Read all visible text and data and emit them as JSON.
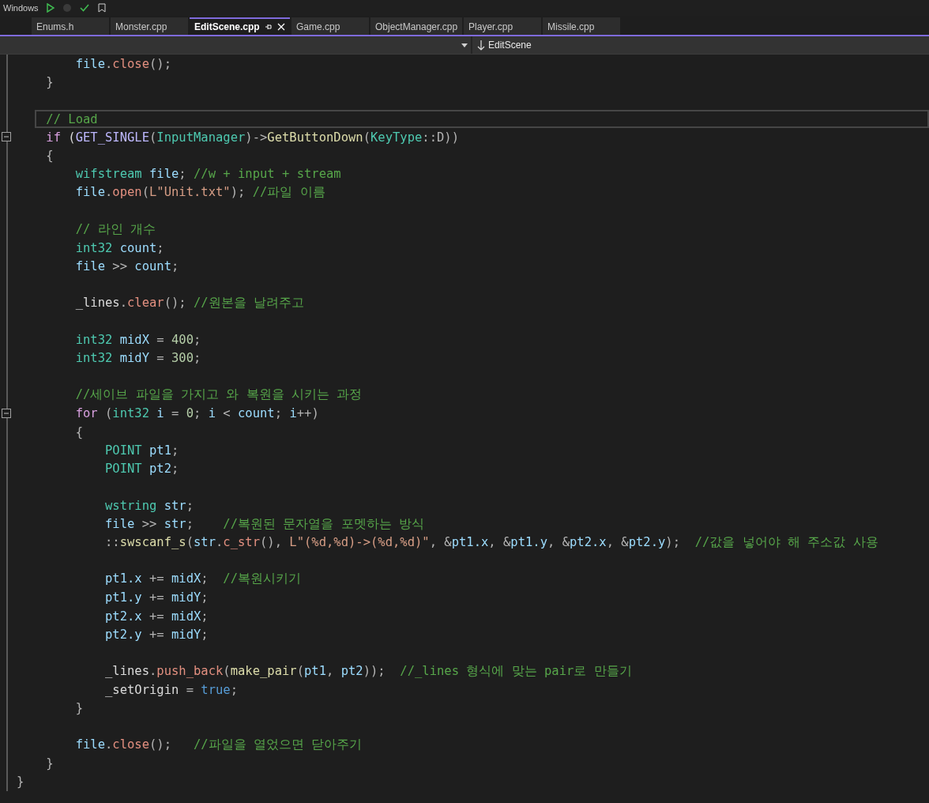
{
  "toolbar": {
    "configuration": "Windows"
  },
  "tabs": [
    {
      "label": "Enums.h",
      "selected": false
    },
    {
      "label": "Monster.cpp",
      "selected": false
    },
    {
      "label": "EditScene.cpp",
      "selected": true
    },
    {
      "label": "Game.cpp",
      "selected": false
    },
    {
      "label": "ObjectManager.cpp",
      "selected": false
    },
    {
      "label": "Player.cpp",
      "selected": false
    },
    {
      "label": "Missile.cpp",
      "selected": false
    }
  ],
  "navigation_bar": {
    "member": "EditScene"
  },
  "code_lines": [
    {
      "fold_marker": false,
      "current": false,
      "tokens": [
        {
          "kind": "var",
          "text": "        file"
        },
        {
          "kind": "punct",
          "text": "."
        },
        {
          "kind": "method",
          "text": "close"
        },
        {
          "kind": "punct",
          "text": "();"
        }
      ]
    },
    {
      "fold_marker": false,
      "current": false,
      "tokens": [
        {
          "kind": "punct",
          "text": "    }"
        }
      ]
    },
    {
      "fold_marker": false,
      "current": false
    },
    {
      "fold_marker": false,
      "current": true,
      "tokens": [
        {
          "kind": "comment",
          "text": "    // Load"
        }
      ]
    },
    {
      "fold_marker": true,
      "current": false,
      "tokens": [
        {
          "kind": "ctl",
          "text": "    if"
        },
        {
          "kind": "plain",
          "text": " ("
        },
        {
          "kind": "macro",
          "text": "GET_SINGLE"
        },
        {
          "kind": "punct",
          "text": "("
        },
        {
          "kind": "type",
          "text": "InputManager"
        },
        {
          "kind": "punct",
          "text": ")->"
        },
        {
          "kind": "fn",
          "text": "GetButtonDown"
        },
        {
          "kind": "punct",
          "text": "("
        },
        {
          "kind": "type",
          "text": "KeyType"
        },
        {
          "kind": "punct",
          "text": "::D))"
        }
      ]
    },
    {
      "fold_marker": false,
      "current": false,
      "tokens": [
        {
          "kind": "punct",
          "text": "    {"
        }
      ]
    },
    {
      "fold_marker": false,
      "current": false,
      "tokens": [
        {
          "kind": "type",
          "text": "        wifstream "
        },
        {
          "kind": "var",
          "text": "file"
        },
        {
          "kind": "punct",
          "text": ";"
        },
        {
          "kind": "comment",
          "text": " //w + input + stream"
        }
      ]
    },
    {
      "fold_marker": false,
      "current": false,
      "tokens": [
        {
          "kind": "var",
          "text": "        file"
        },
        {
          "kind": "punct",
          "text": "."
        },
        {
          "kind": "method",
          "text": "open"
        },
        {
          "kind": "punct",
          "text": "("
        },
        {
          "kind": "str",
          "text": "L\"Unit.txt\""
        },
        {
          "kind": "punct",
          "text": ");"
        },
        {
          "kind": "comment",
          "text": " //파일 이름"
        }
      ]
    },
    {
      "fold_marker": false,
      "current": false
    },
    {
      "fold_marker": false,
      "current": false,
      "tokens": [
        {
          "kind": "comment",
          "text": "        // 라인 개수"
        }
      ]
    },
    {
      "fold_marker": false,
      "current": false,
      "tokens": [
        {
          "kind": "type",
          "text": "        int32 "
        },
        {
          "kind": "var",
          "text": "count"
        },
        {
          "kind": "punct",
          "text": ";"
        }
      ]
    },
    {
      "fold_marker": false,
      "current": false,
      "tokens": [
        {
          "kind": "var",
          "text": "        file"
        },
        {
          "kind": "punct",
          "text": " >> "
        },
        {
          "kind": "var",
          "text": "count"
        },
        {
          "kind": "punct",
          "text": ";"
        }
      ]
    },
    {
      "fold_marker": false,
      "current": false
    },
    {
      "fold_marker": false,
      "current": false,
      "tokens": [
        {
          "kind": "field",
          "text": "        _lines"
        },
        {
          "kind": "punct",
          "text": "."
        },
        {
          "kind": "method",
          "text": "clear"
        },
        {
          "kind": "punct",
          "text": "();"
        },
        {
          "kind": "comment",
          "text": " //원본을 날려주고"
        }
      ]
    },
    {
      "fold_marker": false,
      "current": false
    },
    {
      "fold_marker": false,
      "current": false,
      "tokens": [
        {
          "kind": "type",
          "text": "        int32 "
        },
        {
          "kind": "var",
          "text": "midX"
        },
        {
          "kind": "punct",
          "text": " = "
        },
        {
          "kind": "num",
          "text": "400"
        },
        {
          "kind": "punct",
          "text": ";"
        }
      ]
    },
    {
      "fold_marker": false,
      "current": false,
      "tokens": [
        {
          "kind": "type",
          "text": "        int32 "
        },
        {
          "kind": "var",
          "text": "midY"
        },
        {
          "kind": "punct",
          "text": " = "
        },
        {
          "kind": "num",
          "text": "300"
        },
        {
          "kind": "punct",
          "text": ";"
        }
      ]
    },
    {
      "fold_marker": false,
      "current": false
    },
    {
      "fold_marker": false,
      "current": false,
      "tokens": [
        {
          "kind": "comment",
          "text": "        //세이브 파일을 가지고 와 복원을 시키는 과정"
        }
      ]
    },
    {
      "fold_marker": true,
      "current": false,
      "tokens": [
        {
          "kind": "ctl",
          "text": "        for"
        },
        {
          "kind": "punct",
          "text": " ("
        },
        {
          "kind": "type",
          "text": "int32 "
        },
        {
          "kind": "var",
          "text": "i"
        },
        {
          "kind": "punct",
          "text": " = "
        },
        {
          "kind": "num",
          "text": "0"
        },
        {
          "kind": "punct",
          "text": "; "
        },
        {
          "kind": "var",
          "text": "i"
        },
        {
          "kind": "punct",
          "text": " < "
        },
        {
          "kind": "var",
          "text": "count"
        },
        {
          "kind": "punct",
          "text": "; "
        },
        {
          "kind": "var",
          "text": "i"
        },
        {
          "kind": "punct",
          "text": "++)"
        }
      ]
    },
    {
      "fold_marker": false,
      "current": false,
      "tokens": [
        {
          "kind": "punct",
          "text": "        {"
        }
      ]
    },
    {
      "fold_marker": false,
      "current": false,
      "tokens": [
        {
          "kind": "type",
          "text": "            POINT "
        },
        {
          "kind": "var",
          "text": "pt1"
        },
        {
          "kind": "punct",
          "text": ";"
        }
      ]
    },
    {
      "fold_marker": false,
      "current": false,
      "tokens": [
        {
          "kind": "type",
          "text": "            POINT "
        },
        {
          "kind": "var",
          "text": "pt2"
        },
        {
          "kind": "punct",
          "text": ";"
        }
      ]
    },
    {
      "fold_marker": false,
      "current": false
    },
    {
      "fold_marker": false,
      "current": false,
      "tokens": [
        {
          "kind": "type",
          "text": "            wstring "
        },
        {
          "kind": "var",
          "text": "str"
        },
        {
          "kind": "punct",
          "text": ";"
        }
      ]
    },
    {
      "fold_marker": false,
      "current": false,
      "tokens": [
        {
          "kind": "var",
          "text": "            file"
        },
        {
          "kind": "punct",
          "text": " >> "
        },
        {
          "kind": "var",
          "text": "str"
        },
        {
          "kind": "punct",
          "text": ";    "
        },
        {
          "kind": "comment",
          "text": "//복원된 문자열을 포멧하는 방식"
        }
      ]
    },
    {
      "fold_marker": false,
      "current": false,
      "tokens": [
        {
          "kind": "punct",
          "text": "            ::"
        },
        {
          "kind": "fn",
          "text": "swscanf_s"
        },
        {
          "kind": "punct",
          "text": "("
        },
        {
          "kind": "var",
          "text": "str"
        },
        {
          "kind": "punct",
          "text": "."
        },
        {
          "kind": "method",
          "text": "c_str"
        },
        {
          "kind": "punct",
          "text": "(), "
        },
        {
          "kind": "str",
          "text": "L\"(%d,%d)->(%d,%d)\""
        },
        {
          "kind": "punct",
          "text": ", &"
        },
        {
          "kind": "var",
          "text": "pt1.x"
        },
        {
          "kind": "punct",
          "text": ", &"
        },
        {
          "kind": "var",
          "text": "pt1.y"
        },
        {
          "kind": "punct",
          "text": ", &"
        },
        {
          "kind": "var",
          "text": "pt2.x"
        },
        {
          "kind": "punct",
          "text": ", &"
        },
        {
          "kind": "var",
          "text": "pt2.y"
        },
        {
          "kind": "punct",
          "text": ");  "
        },
        {
          "kind": "comment",
          "text": "//값을 넣어야 해 주소값 사용"
        }
      ]
    },
    {
      "fold_marker": false,
      "current": false
    },
    {
      "fold_marker": false,
      "current": false,
      "tokens": [
        {
          "kind": "var",
          "text": "            pt1.x"
        },
        {
          "kind": "punct",
          "text": " += "
        },
        {
          "kind": "var",
          "text": "midX"
        },
        {
          "kind": "punct",
          "text": ";  "
        },
        {
          "kind": "comment",
          "text": "//복원시키기"
        }
      ]
    },
    {
      "fold_marker": false,
      "current": false,
      "tokens": [
        {
          "kind": "var",
          "text": "            pt1.y"
        },
        {
          "kind": "punct",
          "text": " += "
        },
        {
          "kind": "var",
          "text": "midY"
        },
        {
          "kind": "punct",
          "text": ";"
        }
      ]
    },
    {
      "fold_marker": false,
      "current": false,
      "tokens": [
        {
          "kind": "var",
          "text": "            pt2.x"
        },
        {
          "kind": "punct",
          "text": " += "
        },
        {
          "kind": "var",
          "text": "midX"
        },
        {
          "kind": "punct",
          "text": ";"
        }
      ]
    },
    {
      "fold_marker": false,
      "current": false,
      "tokens": [
        {
          "kind": "var",
          "text": "            pt2.y"
        },
        {
          "kind": "punct",
          "text": " += "
        },
        {
          "kind": "var",
          "text": "midY"
        },
        {
          "kind": "punct",
          "text": ";"
        }
      ]
    },
    {
      "fold_marker": false,
      "current": false
    },
    {
      "fold_marker": false,
      "current": false,
      "tokens": [
        {
          "kind": "field",
          "text": "            _lines"
        },
        {
          "kind": "punct",
          "text": "."
        },
        {
          "kind": "method",
          "text": "push_back"
        },
        {
          "kind": "punct",
          "text": "("
        },
        {
          "kind": "fn",
          "text": "make_pair"
        },
        {
          "kind": "punct",
          "text": "("
        },
        {
          "kind": "var",
          "text": "pt1"
        },
        {
          "kind": "punct",
          "text": ", "
        },
        {
          "kind": "var",
          "text": "pt2"
        },
        {
          "kind": "punct",
          "text": "));  "
        },
        {
          "kind": "comment",
          "text": "//_lines 형식에 맞는 pair로 만들기"
        }
      ]
    },
    {
      "fold_marker": false,
      "current": false,
      "tokens": [
        {
          "kind": "field",
          "text": "            _setOrigin"
        },
        {
          "kind": "punct",
          "text": " = "
        },
        {
          "kind": "kw",
          "text": "true"
        },
        {
          "kind": "punct",
          "text": ";"
        }
      ]
    },
    {
      "fold_marker": false,
      "current": false,
      "tokens": [
        {
          "kind": "punct",
          "text": "        }"
        }
      ]
    },
    {
      "fold_marker": false,
      "current": false
    },
    {
      "fold_marker": false,
      "current": false,
      "tokens": [
        {
          "kind": "var",
          "text": "        file"
        },
        {
          "kind": "punct",
          "text": "."
        },
        {
          "kind": "method",
          "text": "close"
        },
        {
          "kind": "punct",
          "text": "();   "
        },
        {
          "kind": "comment",
          "text": "//파일을 열었으면 닫아주기"
        }
      ]
    },
    {
      "fold_marker": false,
      "current": false,
      "tokens": [
        {
          "kind": "punct",
          "text": "    }"
        }
      ]
    },
    {
      "fold_marker": false,
      "current": false,
      "tokens": [
        {
          "kind": "punct",
          "text": "}"
        }
      ]
    }
  ]
}
